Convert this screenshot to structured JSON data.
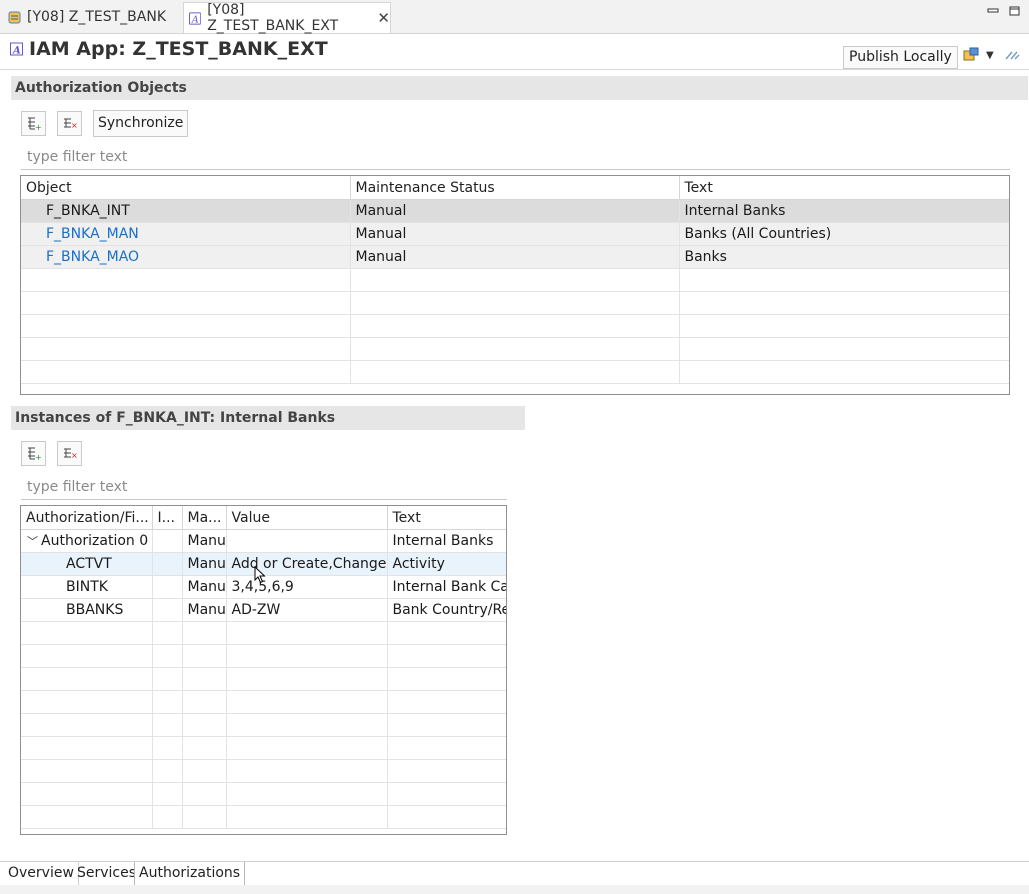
{
  "editor_tabs": [
    {
      "label": "[Y08] Z_TEST_BANK"
    },
    {
      "label": "[Y08] Z_TEST_BANK_EXT"
    }
  ],
  "header": {
    "title": "IAM App: Z_TEST_BANK_EXT",
    "publish_label": "Publish Locally"
  },
  "auth_objects": {
    "title": "Authorization Objects",
    "sync_label": "Synchronize",
    "filter_placeholder": "type filter text",
    "columns": [
      "Object",
      "Maintenance Status",
      "Text"
    ],
    "rows": [
      {
        "object": "F_BNKA_INT",
        "status": "Manual",
        "text": "Internal Banks"
      },
      {
        "object": "F_BNKA_MAN",
        "status": "Manual",
        "text": "Banks (All Countries)"
      },
      {
        "object": "F_BNKA_MAO",
        "status": "Manual",
        "text": "Banks"
      }
    ]
  },
  "instances": {
    "title": "Instances of F_BNKA_INT: Internal Banks",
    "filter_placeholder": "type filter text",
    "columns": [
      "Authorization/Fi...",
      "I...",
      "Ma...",
      "Value",
      "Text"
    ],
    "rows": [
      {
        "name": "Authorization 0",
        "i": "",
        "ma": "Manu",
        "value": "",
        "text": "Internal Banks"
      },
      {
        "name": "ACTVT",
        "i": "",
        "ma": "Manu",
        "value": "Add or Create,Change",
        "text": "Activity"
      },
      {
        "name": "BINTK",
        "i": "",
        "ma": "Manu",
        "value": "3,4,5,6,9",
        "text": "Internal Bank Cat"
      },
      {
        "name": "BBANKS",
        "i": "",
        "ma": "Manu",
        "value": "AD-ZW",
        "text": "Bank Country/Re"
      }
    ]
  },
  "page_tabs": [
    "Overview",
    "Services",
    "Authorizations"
  ],
  "colors": {
    "link": "#1a6fc9",
    "selected_row": "#dcdcdc",
    "hover_row": "#e8f3fb",
    "section_header": "#e6e6e6"
  }
}
